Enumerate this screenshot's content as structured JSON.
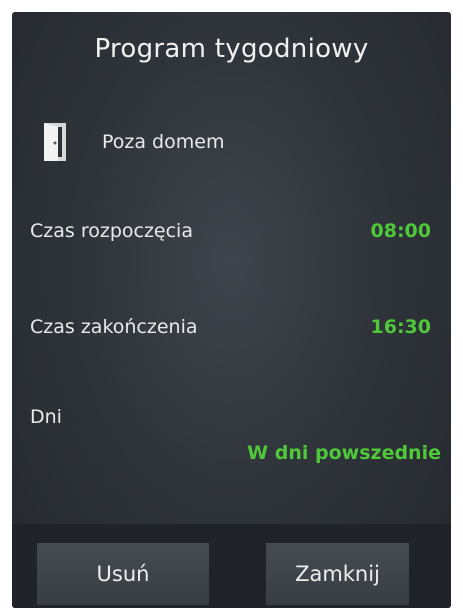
{
  "header": {
    "title": "Program tygodniowy"
  },
  "mode": {
    "icon": "door-icon",
    "label": "Poza domem"
  },
  "rows": [
    {
      "label": "Czas rozpoczęcia",
      "value": "08:00"
    },
    {
      "label": "Czas zakończenia",
      "value": "16:30"
    },
    {
      "label": "Dni",
      "value": "W dni powszednie"
    }
  ],
  "buttons": {
    "delete_label": "Usuń",
    "close_label": "Zamknij"
  },
  "colors": {
    "value_green": "#4fc83a",
    "background": "#30353b",
    "button": "#3f454b"
  }
}
